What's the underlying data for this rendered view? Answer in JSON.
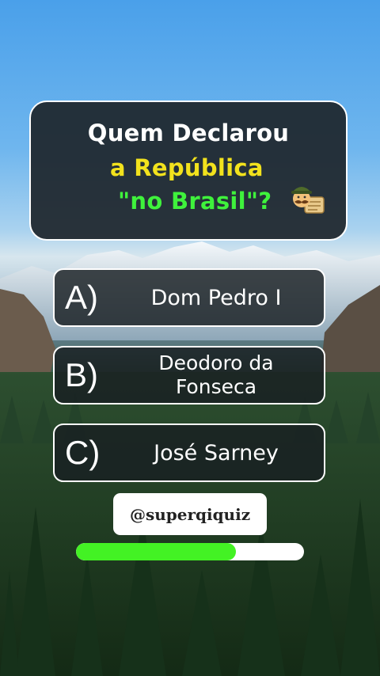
{
  "question": {
    "line1": "Quem Declarou",
    "line2": "a República",
    "line3": "\"no Brasil\"?",
    "icon": "statesman-emoji-icon",
    "colors": {
      "line1": "#ffffff",
      "line2": "#f2e21d",
      "line3": "#3ff23c"
    }
  },
  "answers": [
    {
      "letter": "A)",
      "text": "Dom Pedro I"
    },
    {
      "letter": "B)",
      "text": "Deodoro da Fonseca"
    },
    {
      "letter": "C)",
      "text": "José Sarney"
    }
  ],
  "handle": "@superqiquiz",
  "timer": {
    "progress": 0.7,
    "fill_color": "#43f224",
    "track_color": "#ffffff"
  },
  "background": {
    "scene": "mountains-and-pine-forest"
  }
}
